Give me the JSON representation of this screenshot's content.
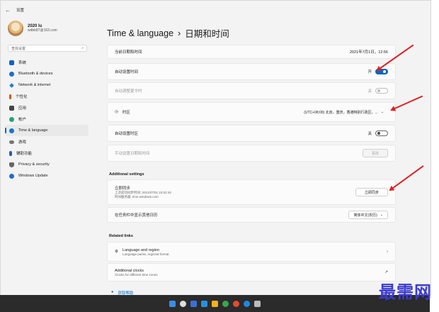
{
  "window": {
    "title": "设置"
  },
  "user": {
    "name": "2020 lu",
    "email": "wdbb87@163.com"
  },
  "search": {
    "placeholder": "查找设置"
  },
  "nav": [
    {
      "label": "系统",
      "color": "#0a64c2"
    },
    {
      "label": "Bluetooth & devices",
      "color": "#1a6ed1"
    },
    {
      "label": "Network & internet",
      "color": "#2d7dd2"
    },
    {
      "label": "个性化",
      "color": "#c55a11"
    },
    {
      "label": "应用",
      "color": "#444"
    },
    {
      "label": "帐户",
      "color": "#2aa07b"
    },
    {
      "label": "Time & language",
      "color": "#1b74c9"
    },
    {
      "label": "游戏",
      "color": "#777"
    },
    {
      "label": "辅助功能",
      "color": "#1d5fb5"
    },
    {
      "label": "Privacy & security",
      "color": "#666"
    },
    {
      "label": "Windows Update",
      "color": "#1a6ed1"
    }
  ],
  "header": {
    "section": "Time & language",
    "separator": "›",
    "page": "日期和时间"
  },
  "rows": {
    "current_time": {
      "label": "当前日期和时间",
      "value": "2021年7月1日，12:56"
    },
    "auto_time": {
      "label": "自动设置时间",
      "state": "开"
    },
    "dst": {
      "label": "自动调整夏令时",
      "state": "关"
    },
    "timezone": {
      "label": "时区",
      "value": "(UTC+08:00) 北京，重庆，香港特别行政区，..."
    },
    "auto_tz": {
      "label": "自动设置时区",
      "state": "关"
    },
    "manual": {
      "label": "手动设置日期和时间",
      "button": "更改"
    }
  },
  "additional": {
    "title": "Additional settings",
    "sync": {
      "title": "立即同步",
      "line1": "上次成功同步时间: 2021/07/01 10:02:43",
      "line2": "时间服务器: time.windows.com",
      "button": "立即同步"
    },
    "calendar": {
      "label": "在任务栏中显示其他日历",
      "value": "简体中文(农历)"
    }
  },
  "related": {
    "title": "Related links",
    "lang": {
      "title": "Language and region",
      "sub": "Language packs, regional format"
    },
    "clocks": {
      "title": "Additional clocks",
      "sub": "Clocks for different time zones"
    },
    "help": "获取帮助"
  },
  "watermark": "最需网",
  "colors": {
    "accent": "#0067c0",
    "annotation_arrow": "#e02020"
  }
}
